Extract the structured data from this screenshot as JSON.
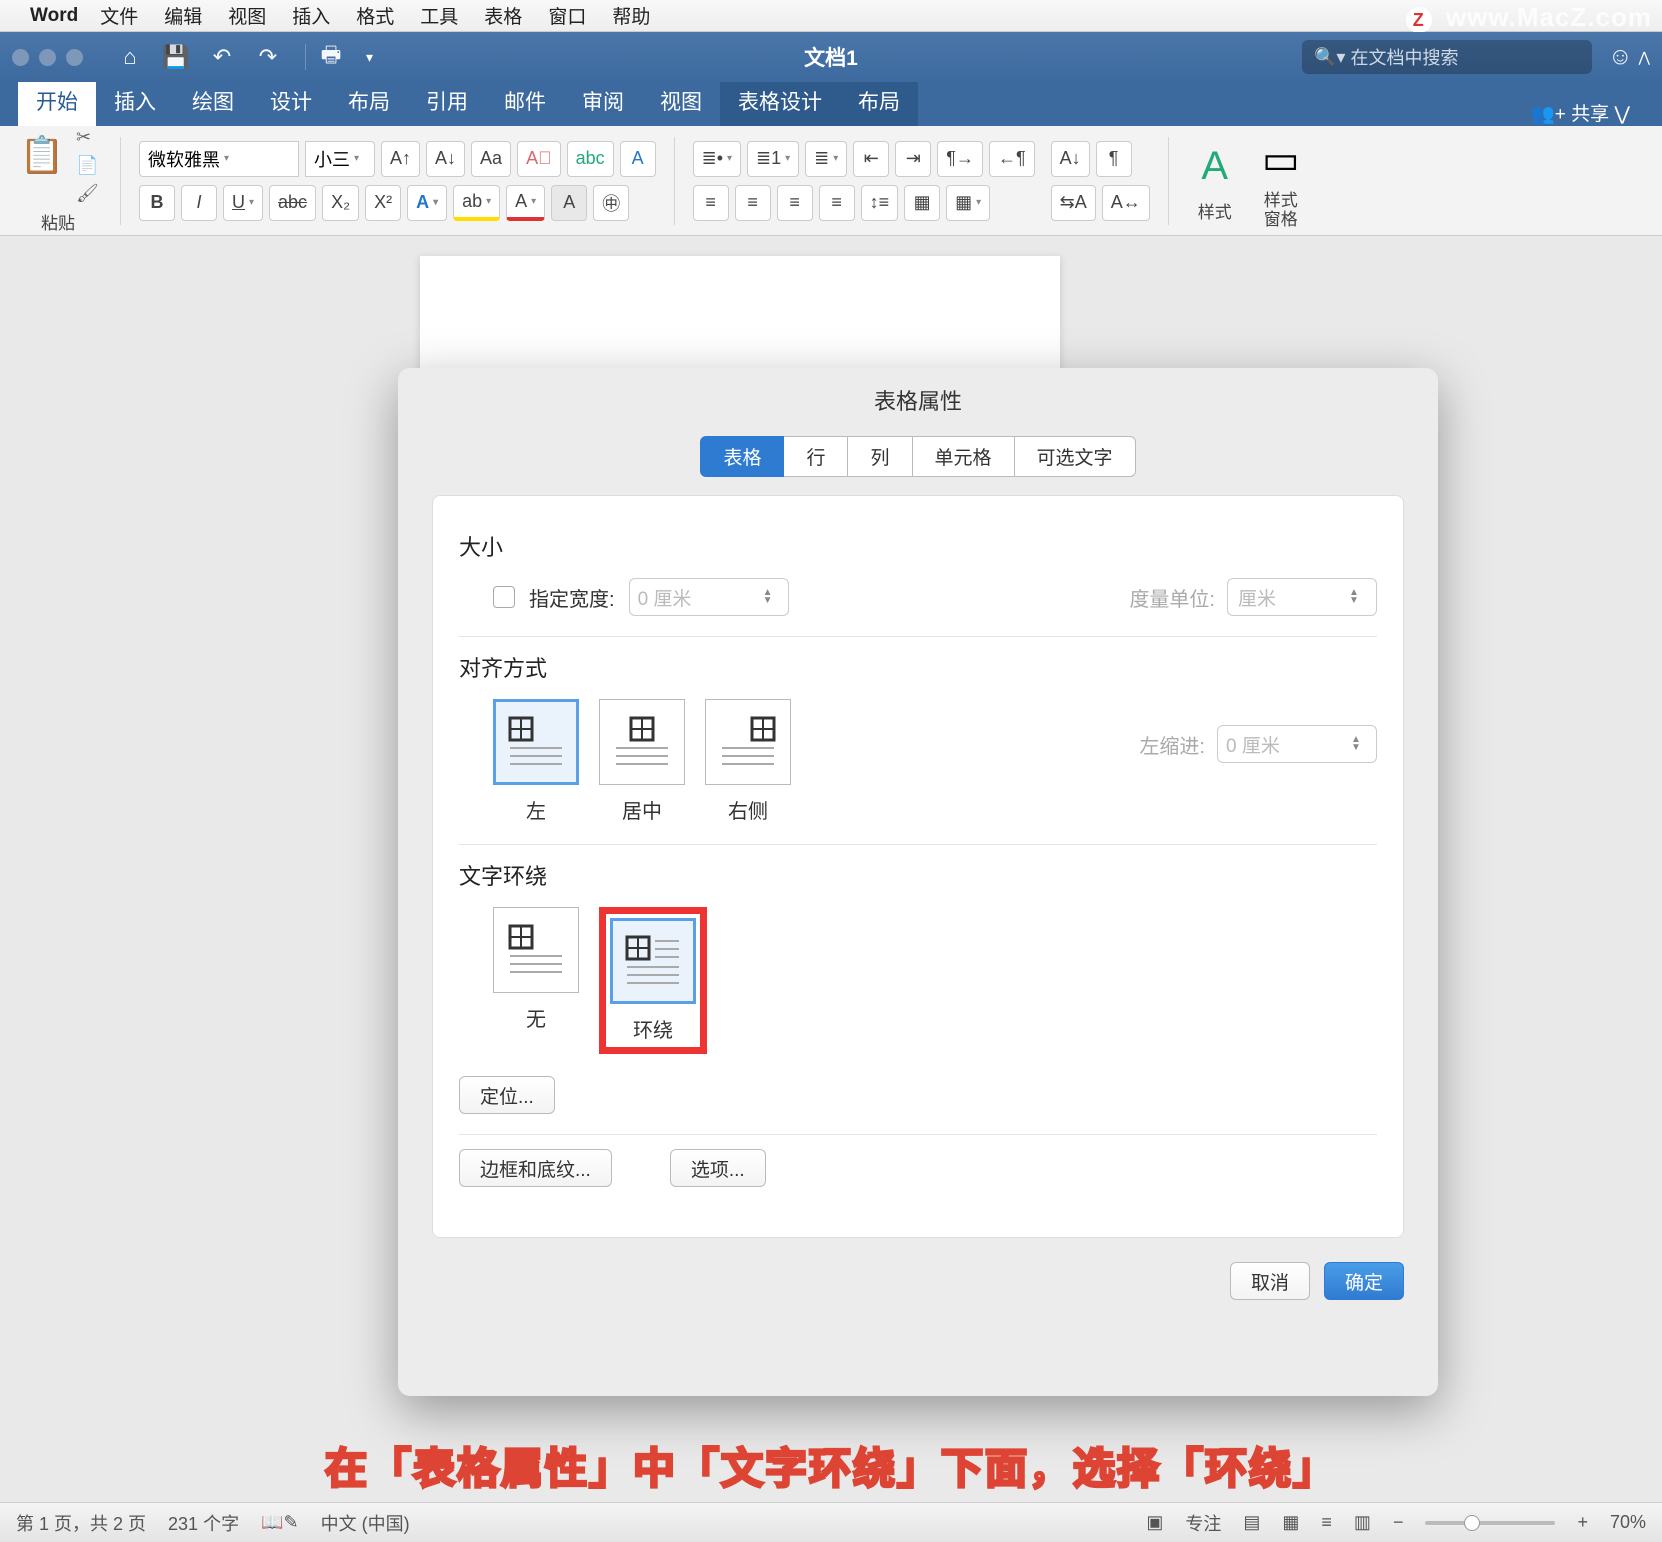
{
  "mac_menu": {
    "apple": "",
    "app": "Word",
    "items": [
      "文件",
      "编辑",
      "视图",
      "插入",
      "格式",
      "工具",
      "表格",
      "窗口",
      "帮助"
    ]
  },
  "watermark": {
    "z": "Z",
    "text": "www.MacZ.com"
  },
  "titlebar": {
    "doc": "文档1",
    "search_ph": "在文档中搜索"
  },
  "ribbon_tabs": [
    "开始",
    "插入",
    "绘图",
    "设计",
    "布局",
    "引用",
    "邮件",
    "审阅",
    "视图",
    "表格设计",
    "布局"
  ],
  "share": "共享",
  "ribbon": {
    "paste": "粘贴",
    "font_name": "微软雅黑",
    "font_size": "小三",
    "styles": "样式",
    "styles_pane": "样式\n窗格",
    "bold": "B",
    "italic": "I",
    "underline": "U",
    "strike": "abc",
    "sub": "X₂",
    "sup": "X²"
  },
  "dialog": {
    "title": "表格属性",
    "tabs": [
      "表格",
      "行",
      "列",
      "单元格",
      "可选文字"
    ],
    "size": {
      "title": "大小",
      "chk": "指定宽度:",
      "width_ph": "0 厘米",
      "unit_lbl": "度量单位:",
      "unit_val": "厘米"
    },
    "align": {
      "title": "对齐方式",
      "opts": [
        "左",
        "居中",
        "右侧"
      ],
      "indent_lbl": "左缩进:",
      "indent_ph": "0 厘米"
    },
    "wrap": {
      "title": "文字环绕",
      "opts": [
        "无",
        "环绕"
      ]
    },
    "pos_btn": "定位...",
    "border_btn": "边框和底纹...",
    "options_btn": "选项...",
    "cancel": "取消",
    "ok": "确定"
  },
  "status": {
    "page": "第 1 页，共 2 页",
    "words": "231 个字",
    "lang": "中文 (中国)",
    "focus": "专注",
    "zoom": "70%"
  },
  "caption": "在「表格属性」中「文字环绕」下面，选择「环绕」"
}
